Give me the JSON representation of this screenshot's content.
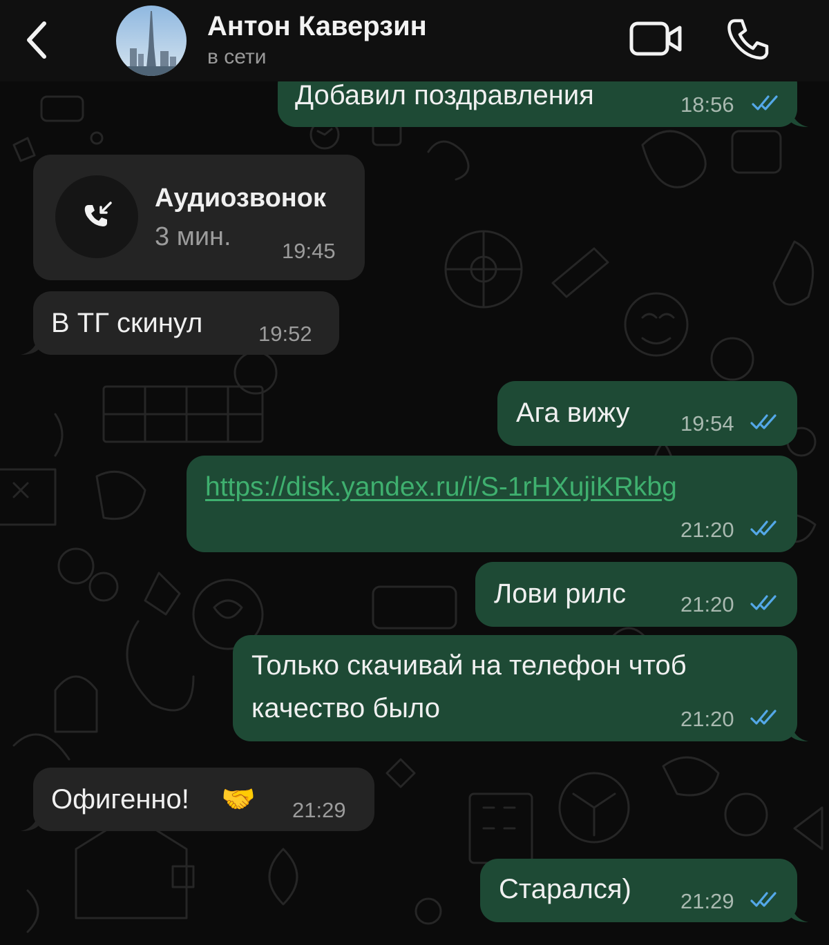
{
  "header": {
    "contact_name": "Антон Каверзин",
    "status": "в сети",
    "icons": {
      "back": "chevron-left-icon",
      "video": "video-camera-icon",
      "call": "phone-icon"
    }
  },
  "colors": {
    "outgoing_bubble": "#1e4a35",
    "incoming_bubble": "#242424",
    "read_ticks": "#54a8e8",
    "link": "#3fb06f",
    "background": "#0b0b0b"
  },
  "messages": [
    {
      "direction": "out",
      "text": "Добавил поздравления",
      "time": "18:56",
      "read": true
    },
    {
      "direction": "in",
      "type": "call",
      "title": "Аудиозвонок",
      "duration": "3 мин.",
      "time": "19:45",
      "icon": "incoming-call-icon"
    },
    {
      "direction": "in",
      "text": "В ТГ скинул",
      "time": "19:52"
    },
    {
      "direction": "out",
      "text": "Ага вижу",
      "time": "19:54",
      "read": true
    },
    {
      "direction": "out",
      "type": "link",
      "text": "https://disk.yandex.ru/i/S-1rHXujiKRkbg",
      "time": "21:20",
      "read": true
    },
    {
      "direction": "out",
      "text": "Лови рилс",
      "time": "21:20",
      "read": true
    },
    {
      "direction": "out",
      "text_line1": "Только скачивай на телефон чтоб",
      "text_line2": "качество было",
      "time": "21:20",
      "read": true
    },
    {
      "direction": "in",
      "text": "Офигенно!",
      "emoji": "🤝",
      "time": "21:29"
    },
    {
      "direction": "out",
      "text": "Старался)",
      "time": "21:29",
      "read": true
    }
  ]
}
